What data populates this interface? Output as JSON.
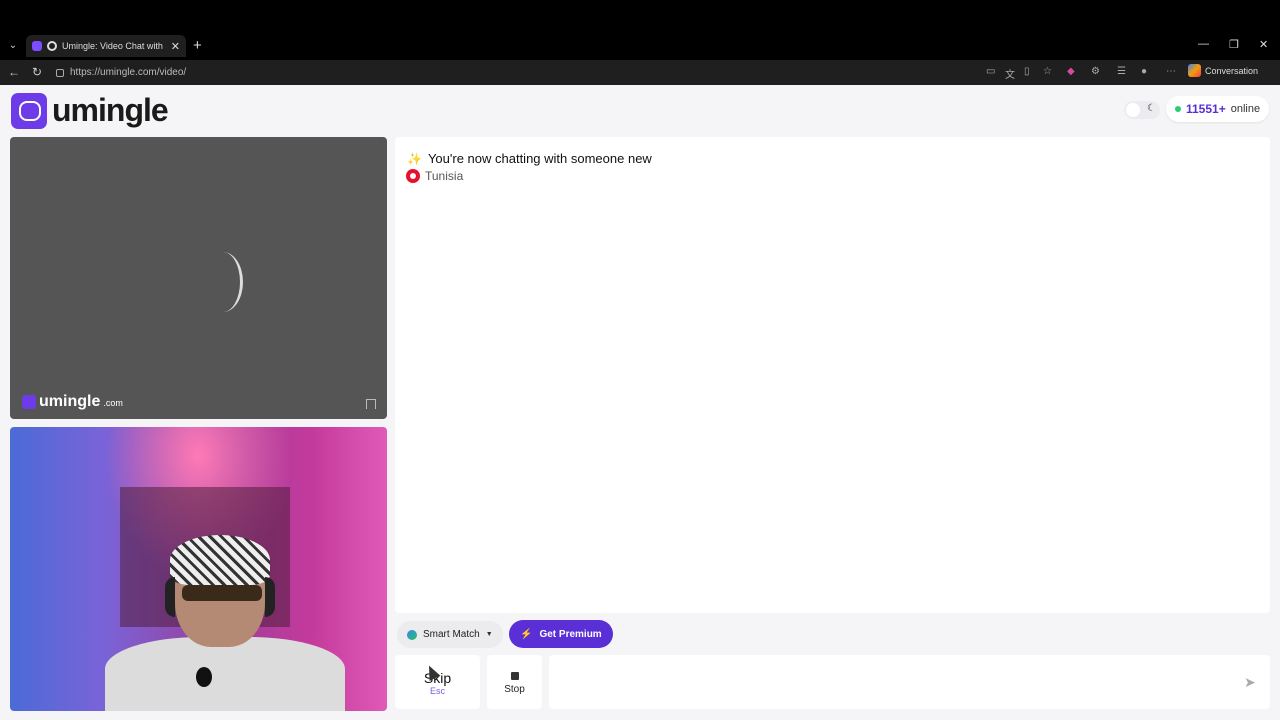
{
  "browser": {
    "tab_title": "Umingle: Video Chat with Stra",
    "url": "https://umingle.com/video/",
    "profile_label": "Conversation"
  },
  "header": {
    "logo_text": "umingle",
    "online_count": "11551+",
    "online_label": "online"
  },
  "remote_video": {
    "watermark_brand": "umingle",
    "watermark_suffix": ".com",
    "loading": true
  },
  "chat": {
    "status_message": "You're now chatting with someone new",
    "partner_country": "Tunisia"
  },
  "controls": {
    "smart_match_label": "Smart Match",
    "premium_label": "Get Premium",
    "skip_label": "Skip",
    "skip_shortcut": "Esc",
    "stop_label": "Stop",
    "input_value": ""
  },
  "colors": {
    "brand": "#5b2fd6",
    "online_dot": "#2ecc71"
  }
}
